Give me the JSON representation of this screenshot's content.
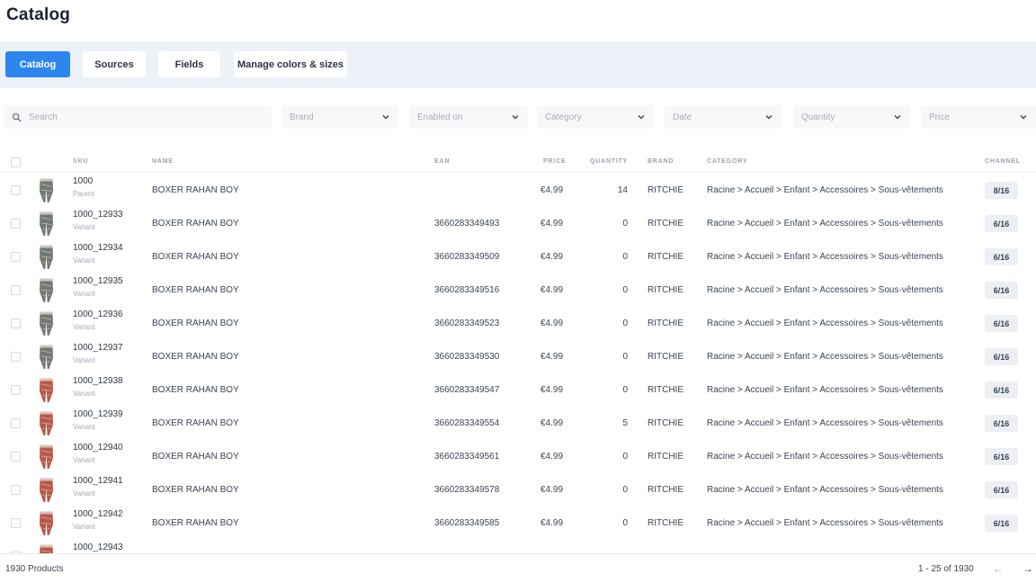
{
  "page": {
    "title": "Catalog"
  },
  "tabs": [
    {
      "label": "Catalog",
      "active": true
    },
    {
      "label": "Sources",
      "active": false
    },
    {
      "label": "Fields",
      "active": false
    },
    {
      "label": "Manage colors & sizes",
      "active": false
    }
  ],
  "search": {
    "placeholder": "Search",
    "icon": "search-icon"
  },
  "filters": [
    {
      "label": "Brand"
    },
    {
      "label": "Enabled on"
    },
    {
      "label": "Category"
    },
    {
      "label": "Date"
    },
    {
      "label": "Quantity"
    },
    {
      "label": "Price"
    }
  ],
  "columns": {
    "sku": "SKU",
    "name": "NAME",
    "ean": "EAN",
    "price": "PRICE",
    "quantity": "QUANTITY",
    "brand": "BRAND",
    "category": "CATEGORY",
    "channel": "CHANNEL"
  },
  "rows": [
    {
      "sku": "1000",
      "type": "Parent",
      "name": "BOXER RAHAN BOY",
      "ean": "",
      "price": "€4.99",
      "quantity": "14",
      "brand": "RITCHIE",
      "category": "Racine > Accueil > Enfant > Accessoires > Sous-vêtements",
      "channel": "8/16",
      "thumb_color": "#6f7a73"
    },
    {
      "sku": "1000_12933",
      "type": "Variant",
      "name": "BOXER RAHAN BOY",
      "ean": "3660283349493",
      "price": "€4.99",
      "quantity": "0",
      "brand": "RITCHIE",
      "category": "Racine > Accueil > Enfant > Accessoires > Sous-vêtements",
      "channel": "6/16",
      "thumb_color": "#6f7a73"
    },
    {
      "sku": "1000_12934",
      "type": "Variant",
      "name": "BOXER RAHAN BOY",
      "ean": "3660283349509",
      "price": "€4.99",
      "quantity": "0",
      "brand": "RITCHIE",
      "category": "Racine > Accueil > Enfant > Accessoires > Sous-vêtements",
      "channel": "6/16",
      "thumb_color": "#6f7a73"
    },
    {
      "sku": "1000_12935",
      "type": "Variant",
      "name": "BOXER RAHAN BOY",
      "ean": "3660283349516",
      "price": "€4.99",
      "quantity": "0",
      "brand": "RITCHIE",
      "category": "Racine > Accueil > Enfant > Accessoires > Sous-vêtements",
      "channel": "6/16",
      "thumb_color": "#6f7a73"
    },
    {
      "sku": "1000_12936",
      "type": "Variant",
      "name": "BOXER RAHAN BOY",
      "ean": "3660283349523",
      "price": "€4.99",
      "quantity": "0",
      "brand": "RITCHIE",
      "category": "Racine > Accueil > Enfant > Accessoires > Sous-vêtements",
      "channel": "6/16",
      "thumb_color": "#6f7a73"
    },
    {
      "sku": "1000_12937",
      "type": "Variant",
      "name": "BOXER RAHAN BOY",
      "ean": "3660283349530",
      "price": "€4.99",
      "quantity": "0",
      "brand": "RITCHIE",
      "category": "Racine > Accueil > Enfant > Accessoires > Sous-vêtements",
      "channel": "6/16",
      "thumb_color": "#6f7a73"
    },
    {
      "sku": "1000_12938",
      "type": "Variant",
      "name": "BOXER RAHAN BOY",
      "ean": "3660283349547",
      "price": "€4.99",
      "quantity": "0",
      "brand": "RITCHIE",
      "category": "Racine > Accueil > Enfant > Accessoires > Sous-vêtements",
      "channel": "6/16",
      "thumb_color": "#b8584a"
    },
    {
      "sku": "1000_12939",
      "type": "Variant",
      "name": "BOXER RAHAN BOY",
      "ean": "3660283349554",
      "price": "€4.99",
      "quantity": "5",
      "brand": "RITCHIE",
      "category": "Racine > Accueil > Enfant > Accessoires > Sous-vêtements",
      "channel": "6/16",
      "thumb_color": "#b8584a"
    },
    {
      "sku": "1000_12940",
      "type": "Variant",
      "name": "BOXER RAHAN BOY",
      "ean": "3660283349561",
      "price": "€4.99",
      "quantity": "0",
      "brand": "RITCHIE",
      "category": "Racine > Accueil > Enfant > Accessoires > Sous-vêtements",
      "channel": "6/16",
      "thumb_color": "#b8584a"
    },
    {
      "sku": "1000_12941",
      "type": "Variant",
      "name": "BOXER RAHAN BOY",
      "ean": "3660283349578",
      "price": "€4.99",
      "quantity": "0",
      "brand": "RITCHIE",
      "category": "Racine > Accueil > Enfant > Accessoires > Sous-vêtements",
      "channel": "6/16",
      "thumb_color": "#b8584a"
    },
    {
      "sku": "1000_12942",
      "type": "Variant",
      "name": "BOXER RAHAN BOY",
      "ean": "3660283349585",
      "price": "€4.99",
      "quantity": "0",
      "brand": "RITCHIE",
      "category": "Racine > Accueil > Enfant > Accessoires > Sous-vêtements",
      "channel": "6/16",
      "thumb_color": "#b8584a"
    },
    {
      "sku": "1000_12943",
      "type": "",
      "name": "",
      "ean": "",
      "price": "",
      "quantity": "",
      "brand": "",
      "category": "",
      "channel": "",
      "thumb_color": "#b8584a"
    }
  ],
  "footer": {
    "count": "1930 Products",
    "range": "1 - 25 of 1930",
    "prev_icon": "←",
    "next_icon": "→"
  },
  "colors": {
    "accent": "#2d86f0",
    "tabbar_bg": "#edf2f8"
  }
}
